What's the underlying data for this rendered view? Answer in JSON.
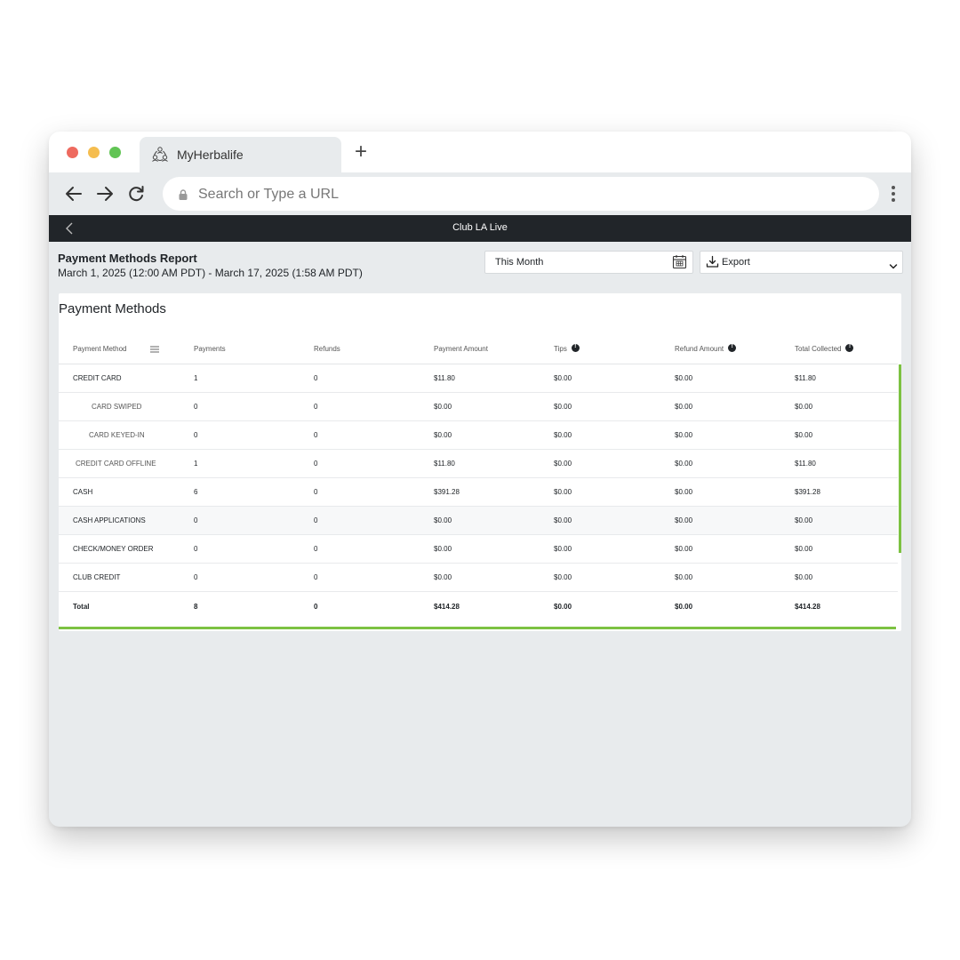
{
  "browser": {
    "tab_title": "MyHerbalife",
    "new_tab_label": "+",
    "url_placeholder": "Search or Type a URL"
  },
  "app_header": {
    "title": "Club LA Live"
  },
  "report": {
    "title": "Payment Methods Report",
    "date_range": "March 1, 2025 (12:00 AM PDT) - March 17, 2025 (1:58 AM PDT)",
    "period_select": "This Month",
    "export_label": "Export"
  },
  "card": {
    "title": "Payment Methods"
  },
  "table": {
    "columns": [
      "Payment Method",
      "Payments",
      "Refunds",
      "Payment Amount",
      "Tips",
      "Refund Amount",
      "Total Collected"
    ],
    "rows": [
      {
        "method": "CREDIT CARD",
        "payments": "1",
        "refunds": "0",
        "payment_amount": "$11.80",
        "tips": "$0.00",
        "refund_amount": "$0.00",
        "total": "$11.80"
      },
      {
        "method": "CARD SWIPED",
        "payments": "0",
        "refunds": "0",
        "payment_amount": "$0.00",
        "tips": "$0.00",
        "refund_amount": "$0.00",
        "total": "$0.00"
      },
      {
        "method": "CARD KEYED-IN",
        "payments": "0",
        "refunds": "0",
        "payment_amount": "$0.00",
        "tips": "$0.00",
        "refund_amount": "$0.00",
        "total": "$0.00"
      },
      {
        "method": "CREDIT CARD OFFLINE",
        "payments": "1",
        "refunds": "0",
        "payment_amount": "$11.80",
        "tips": "$0.00",
        "refund_amount": "$0.00",
        "total": "$11.80"
      },
      {
        "method": "CASH",
        "payments": "6",
        "refunds": "0",
        "payment_amount": "$391.28",
        "tips": "$0.00",
        "refund_amount": "$0.00",
        "total": "$391.28"
      },
      {
        "method": "CASH APPLICATIONS",
        "payments": "0",
        "refunds": "0",
        "payment_amount": "$0.00",
        "tips": "$0.00",
        "refund_amount": "$0.00",
        "total": "$0.00"
      },
      {
        "method": "CHECK/MONEY ORDER",
        "payments": "0",
        "refunds": "0",
        "payment_amount": "$0.00",
        "tips": "$0.00",
        "refund_amount": "$0.00",
        "total": "$0.00"
      },
      {
        "method": "CLUB CREDIT",
        "payments": "0",
        "refunds": "0",
        "payment_amount": "$0.00",
        "tips": "$0.00",
        "refund_amount": "$0.00",
        "total": "$0.00"
      }
    ],
    "total": {
      "label": "Total",
      "payments": "8",
      "refunds": "0",
      "payment_amount": "$414.28",
      "tips": "$0.00",
      "refund_amount": "$0.00",
      "total": "$414.28"
    }
  },
  "colors": {
    "accent": "#7cc242",
    "header_bg": "#212529",
    "page_bg": "#e8ebed"
  }
}
